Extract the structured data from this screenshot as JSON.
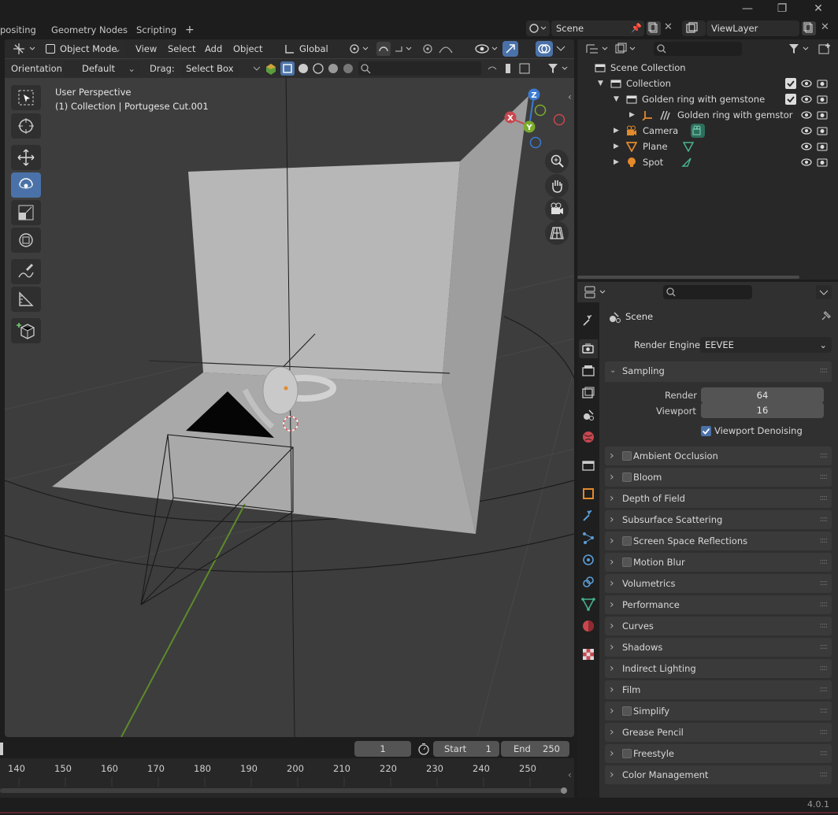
{
  "workspace_tabs": [
    "positing",
    "Geometry Nodes",
    "Scripting",
    "+"
  ],
  "scene": {
    "name": "Scene",
    "view_layer": "ViewLayer"
  },
  "viewport": {
    "header": {
      "mode": "Object Mode",
      "view": "View",
      "select": "Select",
      "add": "Add",
      "object": "Object",
      "transform": "Global"
    },
    "tool_settings": {
      "orientation_label": "Orientation:",
      "orientation_value": "Default",
      "drag_label": "Drag:",
      "drag_value": "Select Box"
    },
    "overlay_title": "User Perspective",
    "overlay_subtitle": "(1) Collection | Portugese Cut.001",
    "gizmo": {
      "z": "Z",
      "x": "X",
      "y": "Y"
    }
  },
  "timeline": {
    "current_frame": "1",
    "start_label": "Start",
    "start_value": "1",
    "end_label": "End",
    "end_value": "250",
    "ticks": [
      "140",
      "150",
      "160",
      "170",
      "180",
      "190",
      "200",
      "210",
      "220",
      "230",
      "240",
      "250"
    ]
  },
  "outliner": {
    "root": "Scene Collection",
    "items": [
      {
        "label": "Collection"
      },
      {
        "label": "Golden ring with gemstone"
      },
      {
        "label": "Golden ring with gemstor"
      },
      {
        "label": "Camera"
      },
      {
        "label": "Plane"
      },
      {
        "label": "Spot"
      }
    ]
  },
  "properties": {
    "context": "Scene",
    "render_engine_label": "Render Engine",
    "render_engine_value": "EEVEE",
    "sampling": {
      "title": "Sampling",
      "render_label": "Render",
      "render_value": "64",
      "viewport_label": "Viewport",
      "viewport_value": "16",
      "denoise_label": "Viewport Denoising"
    },
    "panels": [
      {
        "label": "Ambient Occlusion",
        "checkbox": true
      },
      {
        "label": "Bloom",
        "checkbox": true
      },
      {
        "label": "Depth of Field",
        "checkbox": false
      },
      {
        "label": "Subsurface Scattering",
        "checkbox": false
      },
      {
        "label": "Screen Space Reflections",
        "checkbox": true
      },
      {
        "label": "Motion Blur",
        "checkbox": true
      },
      {
        "label": "Volumetrics",
        "checkbox": false
      },
      {
        "label": "Performance",
        "checkbox": false
      },
      {
        "label": "Curves",
        "checkbox": false
      },
      {
        "label": "Shadows",
        "checkbox": false
      },
      {
        "label": "Indirect Lighting",
        "checkbox": false
      },
      {
        "label": "Film",
        "checkbox": false
      },
      {
        "label": "Simplify",
        "checkbox": true
      },
      {
        "label": "Grease Pencil",
        "checkbox": false
      },
      {
        "label": "Freestyle",
        "checkbox": true
      },
      {
        "label": "Color Management",
        "checkbox": false
      }
    ]
  },
  "status": {
    "version": "4.0.1"
  },
  "colors": {
    "accent": "#4a72a8",
    "x_axis": "#c9474f",
    "y_axis": "#7bab2c",
    "z_axis": "#3b7bd1"
  }
}
